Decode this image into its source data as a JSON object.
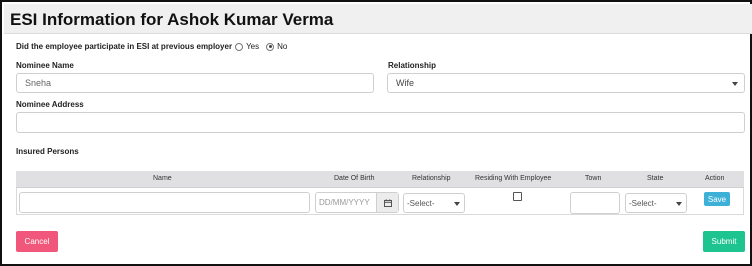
{
  "page": {
    "title": "ESI Information for Ashok Kumar Verma"
  },
  "esi_question": {
    "text": "Did the employee participate in ESI at previous employer",
    "options": [
      "Yes",
      "No"
    ],
    "selected": "No"
  },
  "nominee": {
    "name_label": "Nominee Name",
    "name_value": "Sneha",
    "relationship_label": "Relationship",
    "relationship_value": "Wife",
    "address_label": "Nominee Address",
    "address_value": ""
  },
  "insured": {
    "section_label": "Insured Persons",
    "columns": [
      "Name",
      "Date Of Birth",
      "Relationship",
      "Residing With Employee",
      "Town",
      "State",
      "Action"
    ],
    "row": {
      "name_value": "",
      "dob_placeholder": "DD/MM/YYYY",
      "relationship_value": "-Select-",
      "residing_checked": false,
      "town_value": "",
      "state_value": "-Select-",
      "save_label": "Save"
    }
  },
  "footer": {
    "cancel_label": "Cancel",
    "submit_label": "Submit"
  },
  "colors": {
    "cancel": "#f0577b",
    "submit": "#1ec48f",
    "save": "#3db0d8",
    "header_bg": "#f0f0f0",
    "table_header_bg": "#e0e0e3"
  },
  "icons": [
    "calendar-icon",
    "chevron-down-icon"
  ]
}
